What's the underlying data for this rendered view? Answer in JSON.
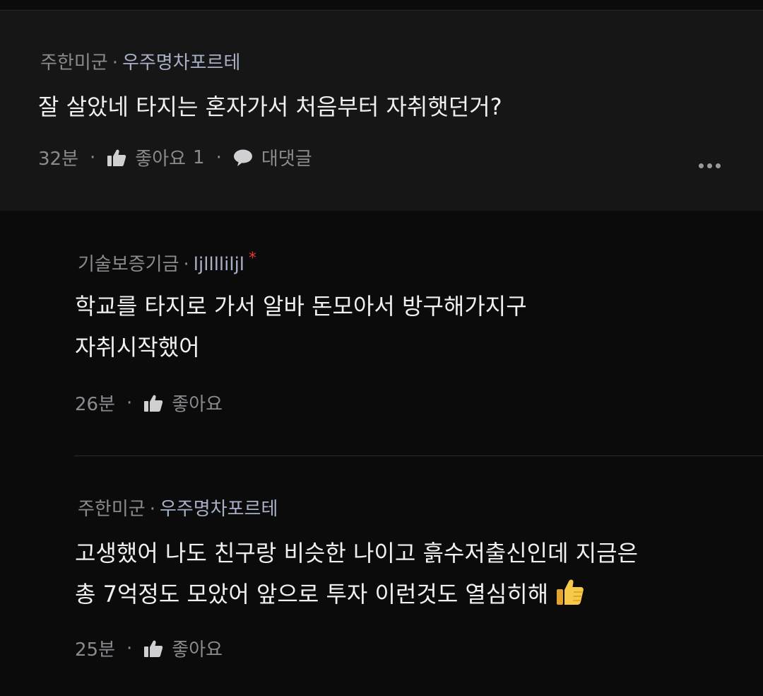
{
  "comments": [
    {
      "board": "주한미군",
      "nickname": "우주명차포르테",
      "text_lines": [
        "잘 살았네 타지는 혼자가서 처음부터 자취햇던거?"
      ],
      "time": "32분",
      "like_label": "좋아요",
      "like_count": "1",
      "reply_label": "대댓글"
    },
    {
      "board": "기술보증기금",
      "nickname": "ljlllliljl",
      "star": "*",
      "text_lines": [
        "학교를 타지로 가서 알바 돈모아서 방구해가지구",
        "자취시작했어"
      ],
      "time": "26분",
      "like_label": "좋아요"
    },
    {
      "board": "주한미군",
      "nickname": "우주명차포르테",
      "text_lines": [
        "고생했어 나도 친구랑 비슷한 나이고 흙수저출신인데 지금은",
        "총 7억정도 모았어 앞으로 투자 이런것도 열심히해"
      ],
      "emoji": "thumbs-up-emoji",
      "time": "25분",
      "like_label": "좋아요"
    }
  ],
  "separator": "·",
  "colors": {
    "background": "#0b0b0c",
    "parent_bg": "#161617",
    "meta": "#8b8b8f",
    "nickname": "#a7b0c6",
    "star": "#e53935"
  }
}
